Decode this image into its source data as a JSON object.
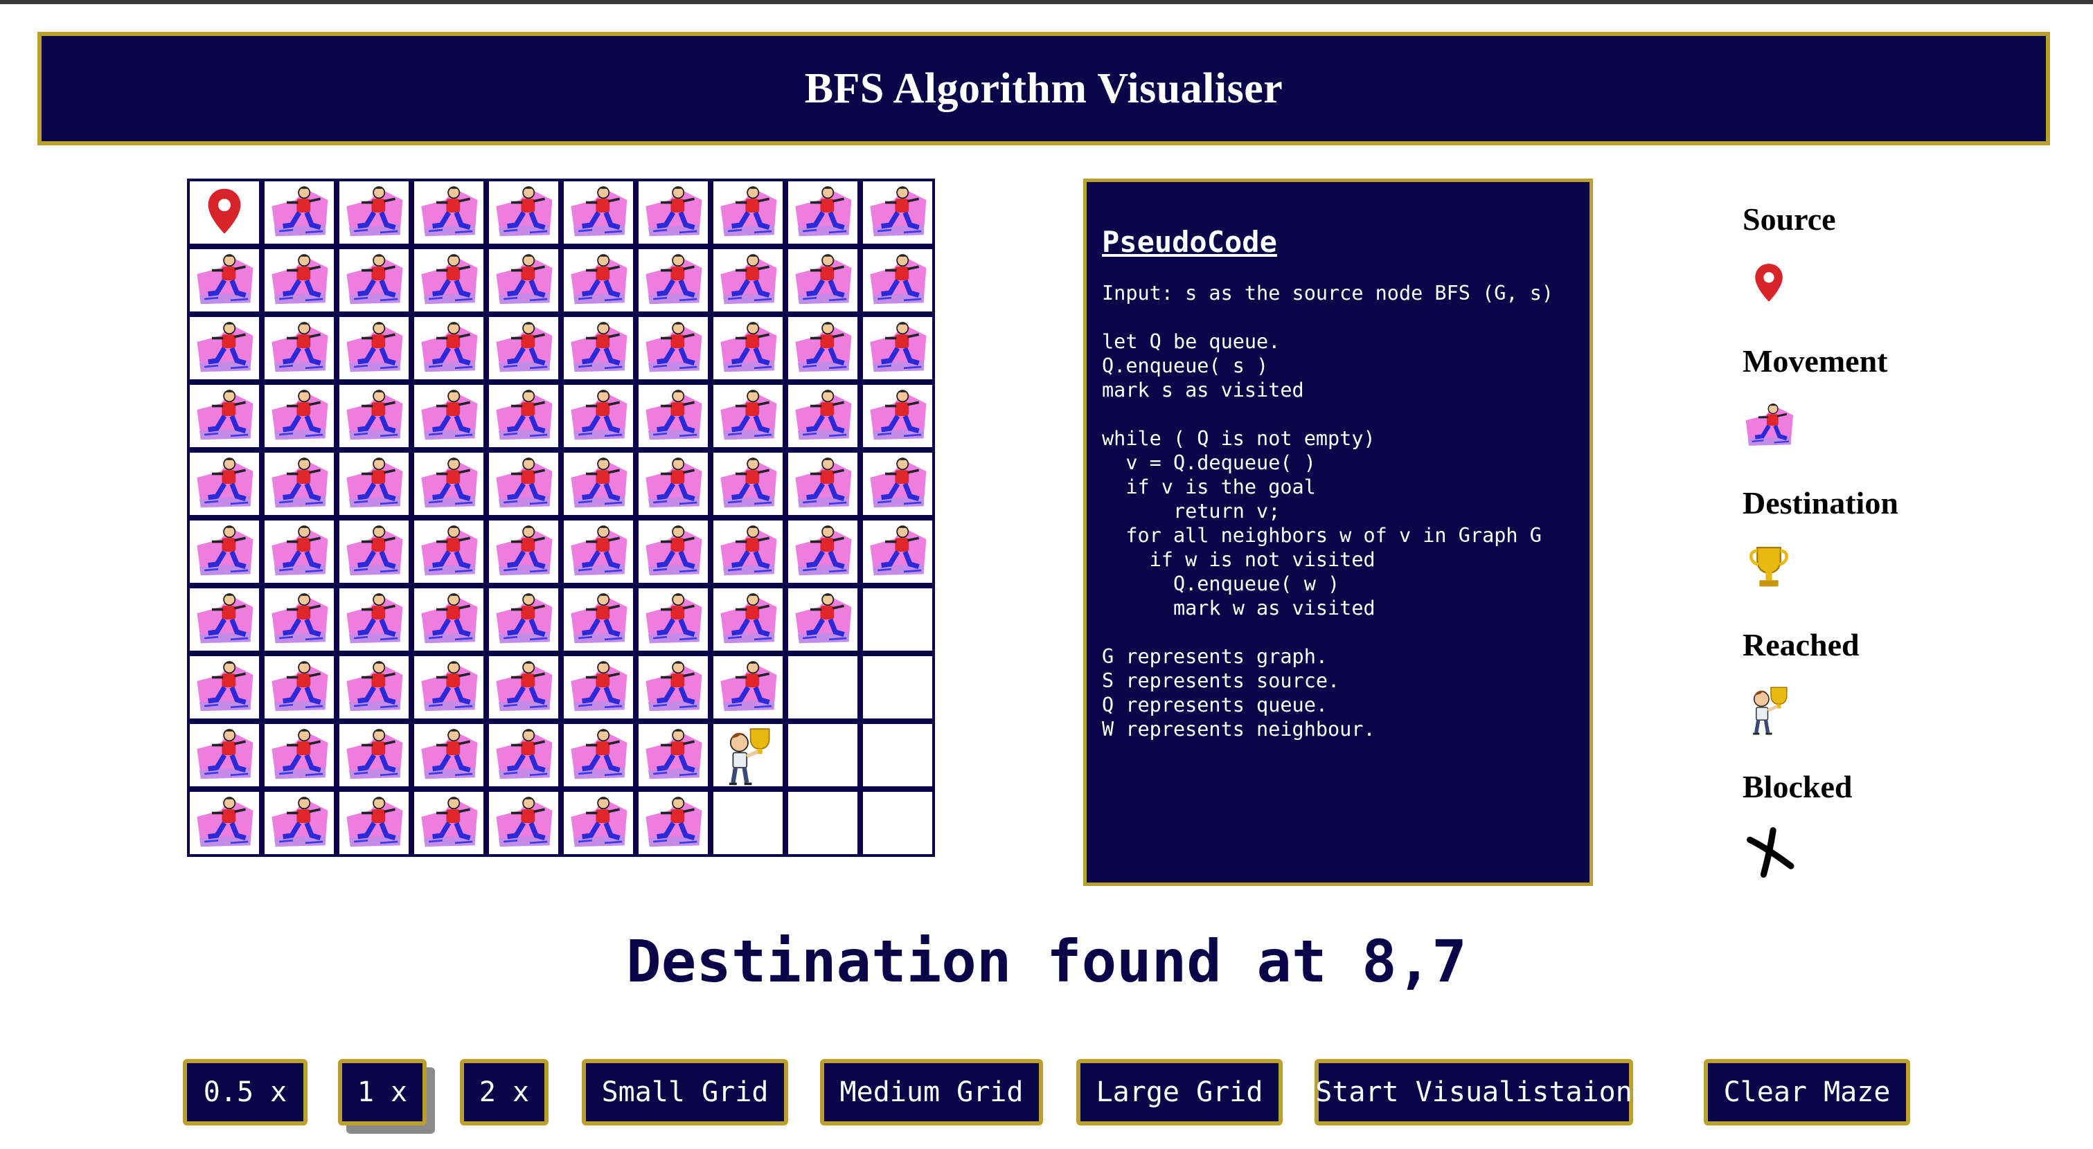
{
  "header": {
    "title": "BFS Algorithm Visualiser"
  },
  "grid": {
    "rows": [
      "SMMMMMMMMM",
      "MMMMMMMMMM",
      "MMMMMMMMMM",
      "MMMMMMMMMM",
      "MMMMMMMMMM",
      "MMMMMMMMMM",
      "MMMMMMMMME",
      "MMMMMMMMEE",
      "MMMMMMMREE",
      "MMMMMMMEEE"
    ]
  },
  "pseudocode": {
    "title": "PseudoCode",
    "lines": [
      "Input: s as the source node BFS (G, s)",
      "",
      "let Q be queue.",
      "Q.enqueue( s )",
      "mark s as visited",
      "",
      "while ( Q is not empty)",
      "  v = Q.dequeue( )",
      "  if v is the goal",
      "      return v;",
      "  for all neighbors w of v in Graph G",
      "    if w is not visited",
      "      Q.enqueue( w )",
      "      mark w as visited",
      "",
      "G represents graph.",
      "S represents source.",
      "Q represents queue.",
      "W represents neighbour."
    ]
  },
  "legend": {
    "items": [
      {
        "label": "Source",
        "icon": "map-pin-icon"
      },
      {
        "label": "Movement",
        "icon": "runner-icon"
      },
      {
        "label": "Destination",
        "icon": "trophy-icon"
      },
      {
        "label": "Reached",
        "icon": "person-with-trophy-icon"
      },
      {
        "label": "Blocked",
        "icon": "x-mark-icon"
      }
    ]
  },
  "status": {
    "text": "Destination found at 8,7"
  },
  "controls": {
    "speed_half": "0.5 x",
    "speed_1": "1 x",
    "speed_2": "2 x",
    "small_grid": "Small Grid",
    "medium_grid": "Medium Grid",
    "large_grid": "Large Grid",
    "start": "Start Visualistaion",
    "clear": "Clear Maze"
  },
  "colors": {
    "navy": "#0a0548",
    "gold": "#bca02f",
    "pin": "#d8232a"
  }
}
